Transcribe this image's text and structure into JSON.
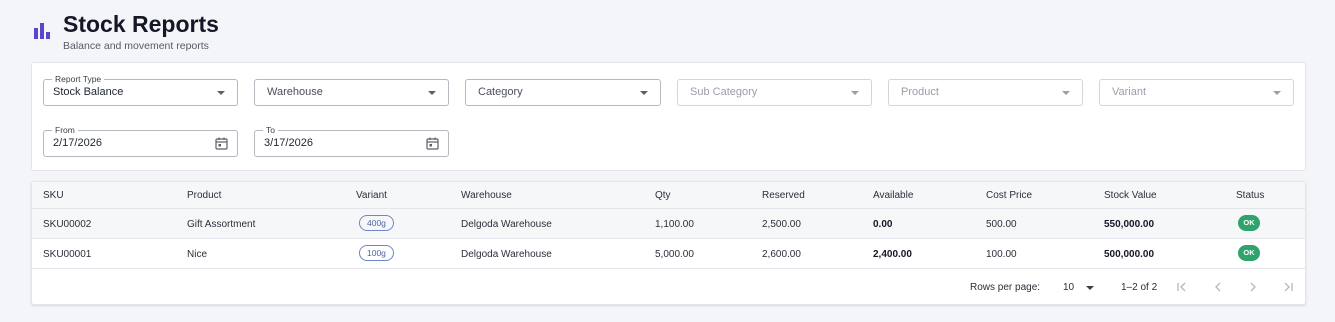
{
  "header": {
    "title": "Stock Reports",
    "subtitle": "Balance and movement reports",
    "icon": "bar-chart-icon",
    "accent": "#5b46c9"
  },
  "filters": {
    "report_type": {
      "label": "Report Type",
      "value": "Stock Balance"
    },
    "warehouse": {
      "placeholder": "Warehouse"
    },
    "category": {
      "placeholder": "Category"
    },
    "sub_category": {
      "placeholder": "Sub Category"
    },
    "product": {
      "placeholder": "Product"
    },
    "variant": {
      "placeholder": "Variant"
    },
    "from": {
      "label": "From",
      "value": "2/17/2026"
    },
    "to": {
      "label": "To",
      "value": "3/17/2026"
    }
  },
  "table": {
    "columns": [
      "SKU",
      "Product",
      "Variant",
      "Warehouse",
      "Qty",
      "Reserved",
      "Available",
      "Cost Price",
      "Stock Value",
      "Status"
    ],
    "rows": [
      {
        "sku": "SKU00002",
        "product": "Gift Assortment",
        "variant": "400g",
        "warehouse": "Delgoda Warehouse",
        "qty": "1,100.00",
        "reserved": "2,500.00",
        "available": "0.00",
        "cost_price": "500.00",
        "stock_value": "550,000.00",
        "status": "OK"
      },
      {
        "sku": "SKU00001",
        "product": "Nice",
        "variant": "100g",
        "warehouse": "Delgoda Warehouse",
        "qty": "5,000.00",
        "reserved": "2,600.00",
        "available": "2,400.00",
        "cost_price": "100.00",
        "stock_value": "500,000.00",
        "status": "OK"
      }
    ],
    "status_color": "#2fa36b"
  },
  "pagination": {
    "rows_per_page_label": "Rows per page:",
    "rows_per_page": "10",
    "range": "1–2 of 2"
  }
}
